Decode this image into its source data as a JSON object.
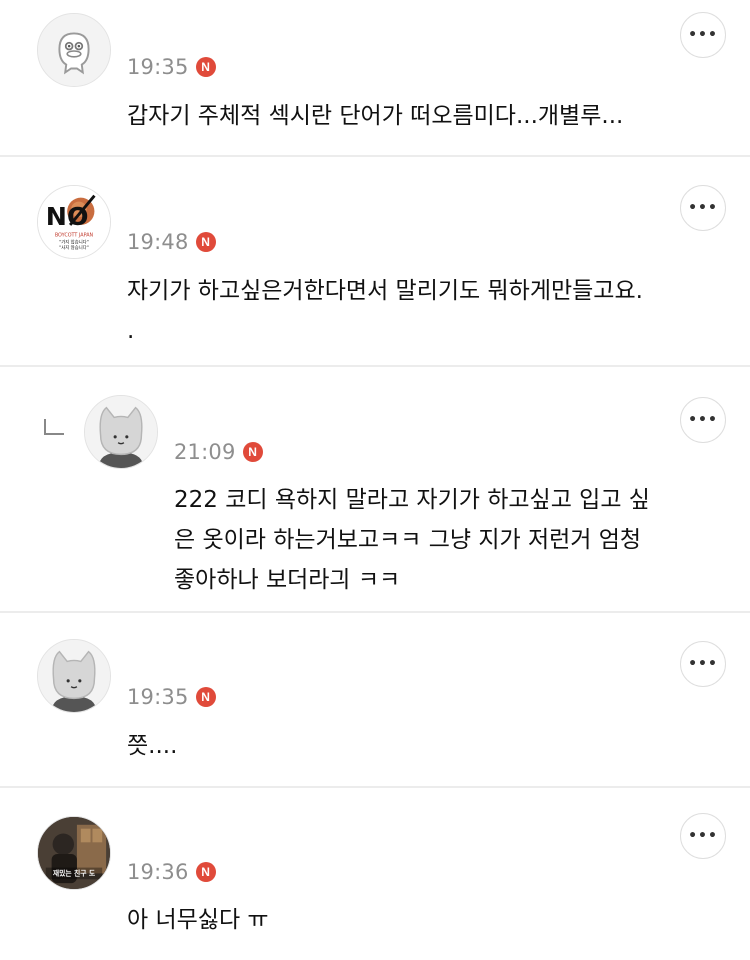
{
  "comments": [
    {
      "time": "19:35",
      "badge": "N",
      "text": "갑자기 주체적 섹시란 단어가 떠오름미다...개별루...",
      "avatar": "duck-avatar"
    },
    {
      "time": "19:48",
      "badge": "N",
      "text": "자기가 하고싶은거한다면서 말리기도 뭐하게만들고요.",
      "text2": ".",
      "avatar": "no-boycott-japan-avatar",
      "avatar_text": {
        "big": "NO",
        "sub": "BOYCOTT JAPAN",
        "l1": "\"가지 않습니다\"",
        "l2": "\"사지 않습니다\""
      }
    },
    {
      "time": "21:09",
      "badge": "N",
      "text": "222 코디 욕하지 말라고 자기가 하고싶고 입고 싶",
      "text2": "은 옷이라 하는거보고ㅋㅋ 그냥 지가 저런거 엄청",
      "text3": "좋아하나 보더라긔 ㅋㅋ",
      "avatar": "cat-avatar"
    },
    {
      "time": "19:35",
      "badge": "N",
      "text": "쯧....",
      "avatar": "cat-avatar"
    },
    {
      "time": "19:36",
      "badge": "N",
      "text": "아 너무싫다 ㅠ",
      "avatar": "photo-avatar",
      "avatar_caption": "재밌는 친구 도"
    }
  ],
  "more_label": "•••"
}
